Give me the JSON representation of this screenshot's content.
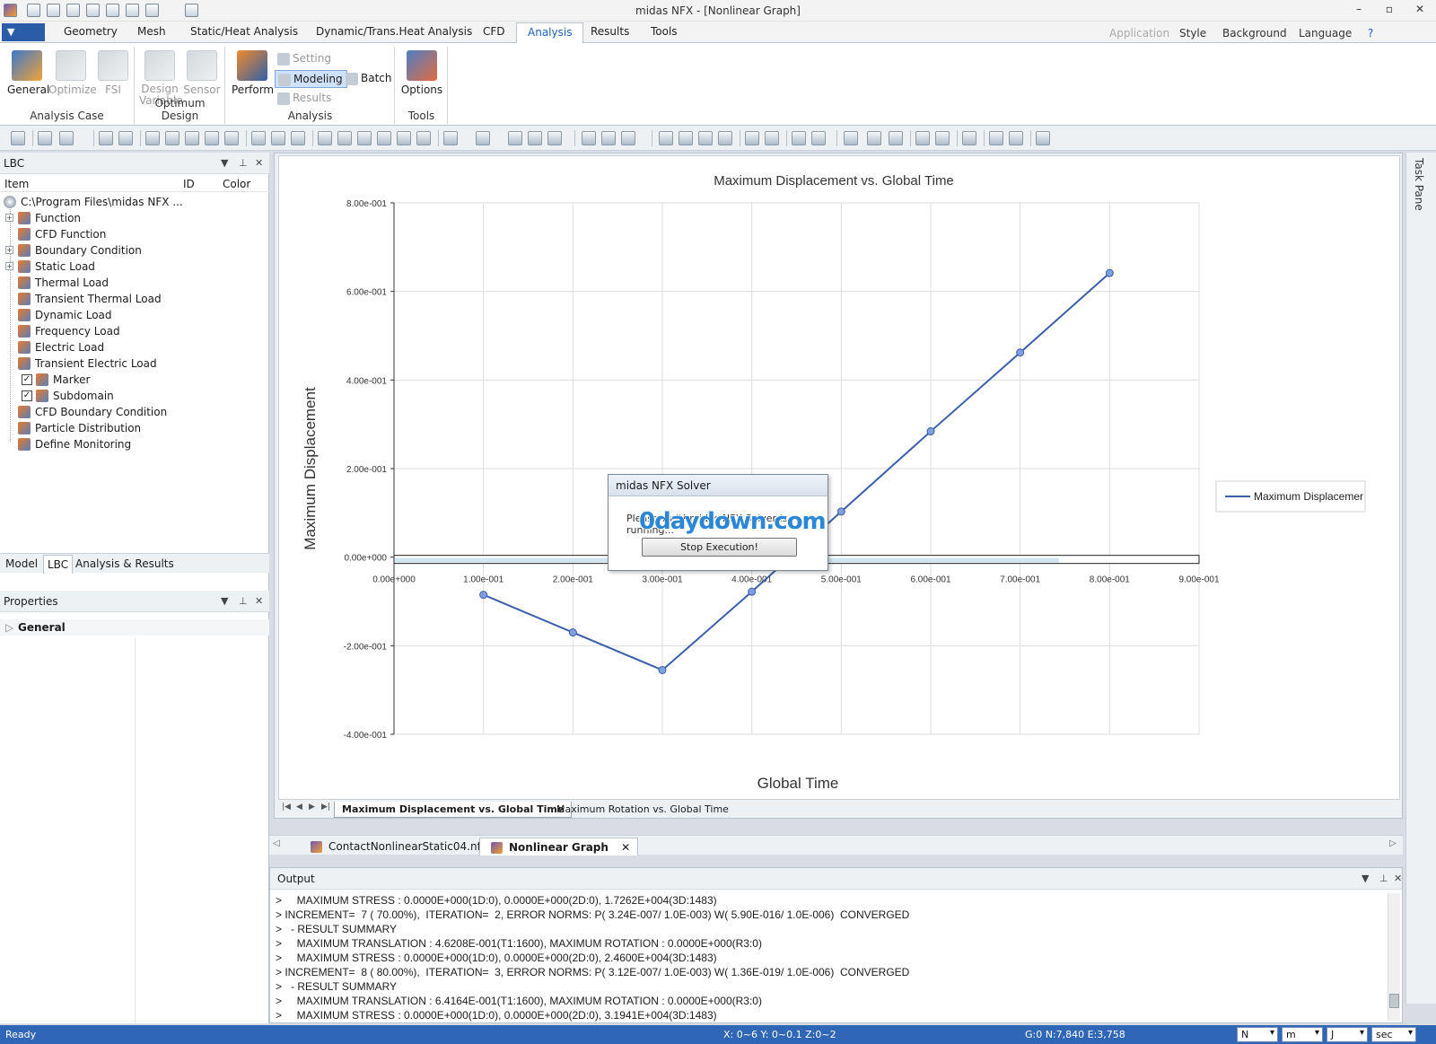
{
  "window": {
    "title": "midas NFX - [Nonlinear Graph]",
    "controls": [
      "–",
      "▫",
      "✕"
    ]
  },
  "menu": {
    "tabs": [
      "Geometry",
      "Mesh",
      "Static/Heat Analysis",
      "Dynamic/Trans.Heat Analysis",
      "CFD",
      "Analysis",
      "Results",
      "Tools"
    ],
    "active": "Analysis",
    "right": [
      "Application",
      "Style",
      "Background",
      "Language"
    ]
  },
  "ribbon": {
    "groups": [
      {
        "label": "Analysis Case",
        "buttons": [
          "General",
          "Optimize",
          "FSI"
        ]
      },
      {
        "label": "Optimum Design",
        "buttons": [
          "Design Variable",
          "Sensor"
        ]
      },
      {
        "label": "Analysis",
        "buttons": [
          "Perform",
          "Setting",
          "Modeling",
          "Results",
          "Batch"
        ]
      },
      {
        "label": "Tools",
        "buttons": [
          "Options"
        ]
      }
    ]
  },
  "lbc_panel": {
    "title": "LBC",
    "columns": [
      "Item",
      "ID",
      "Color"
    ],
    "root": "C:\\Program Files\\midas NFX ...",
    "items": [
      "Function",
      "CFD Function",
      "Boundary Condition",
      "Static Load",
      "Thermal Load",
      "Transient Thermal Load",
      "Dynamic Load",
      "Frequency Load",
      "Electric Load",
      "Transient Electric Load",
      "Marker",
      "Subdomain",
      "CFD Boundary Condition",
      "Particle Distribution",
      "Define Monitoring"
    ],
    "tabs": [
      "Model",
      "LBC",
      "Analysis & Results"
    ],
    "active_tab": "LBC"
  },
  "properties_panel": {
    "title": "Properties",
    "group": "General"
  },
  "chart_data": {
    "type": "line",
    "title": "Maximum Displacement vs. Global Time",
    "xlabel": "Global Time",
    "ylabel": "Maximum Displacement",
    "x": [
      0.1,
      0.2,
      0.3,
      0.4,
      0.5,
      0.6,
      0.7,
      0.8
    ],
    "series": [
      {
        "name": "Maximum Displacemer",
        "values": [
          -0.085,
          -0.17,
          -0.255,
          -0.078,
          0.103,
          0.284,
          0.462,
          0.6416
        ]
      }
    ],
    "xlim": [
      0,
      0.9
    ],
    "ylim": [
      -0.4,
      0.8
    ],
    "x_ticks": [
      "0.00e+000",
      "1.00e-001",
      "2.00e-001",
      "3.00e-001",
      "4.00e-001",
      "5.00e-001",
      "6.00e-001",
      "7.00e-001",
      "8.00e-001",
      "9.00e-001"
    ],
    "y_ticks": [
      "-4.00e-001",
      "-2.00e-001",
      "0.00e+000",
      "2.00e-001",
      "4.00e-001",
      "6.00e-001",
      "8.00e-001"
    ],
    "grid": true,
    "legend": "right",
    "line_color": "#3a5ea8"
  },
  "sheet_tabs": [
    "Maximum Displacement vs. Global Time",
    "Maximum Rotation vs. Global Time"
  ],
  "doc_tabs": [
    "ContactNonlinearStatic04.nfx",
    "Nonlinear Graph"
  ],
  "dialog": {
    "title": "midas NFX Solver",
    "message": "Please wait! midas NFX Solver is running...",
    "button": "Stop Execution!",
    "watermark": "0daydown.com"
  },
  "output": {
    "title": "Output",
    "lines": [
      ">     MAXIMUM STRESS : 0.0000E+000(1D:0), 0.0000E+000(2D:0), 1.7262E+004(3D:1483)",
      "> INCREMENT=  7 ( 70.00%),  ITERATION=  2, ERROR NORMS: P( 3.24E-007/ 1.0E-003) W( 5.90E-016/ 1.0E-006)  CONVERGED",
      ">   - RESULT SUMMARY",
      ">     MAXIMUM TRANSLATION : 4.6208E-001(T1:1600), MAXIMUM ROTATION : 0.0000E+000(R3:0)",
      ">     MAXIMUM STRESS : 0.0000E+000(1D:0), 0.0000E+000(2D:0), 2.4600E+004(3D:1483)",
      "> INCREMENT=  8 ( 80.00%),  ITERATION=  3, ERROR NORMS: P( 3.12E-007/ 1.0E-003) W( 1.36E-019/ 1.0E-006)  CONVERGED",
      ">   - RESULT SUMMARY",
      ">     MAXIMUM TRANSLATION : 6.4164E-001(T1:1600), MAXIMUM ROTATION : 0.0000E+000(R3:0)",
      ">     MAXIMUM STRESS : 0.0000E+000(1D:0), 0.0000E+000(2D:0), 3.1941E+004(3D:1483)"
    ]
  },
  "task_pane": "Task Pane",
  "status": {
    "left": "Ready",
    "coords": "X: 0~6 Y: 0~0.1 Z:0~2",
    "mesh": "G:0  N:7,840  E:3,758",
    "units": [
      "N",
      "m",
      "J",
      "sec"
    ]
  }
}
